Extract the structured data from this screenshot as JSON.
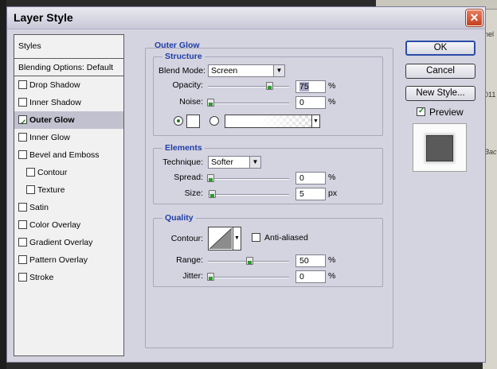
{
  "window": {
    "title": "Layer Style",
    "close_glyph": "✕"
  },
  "background_app": {
    "fragments": [
      "nel",
      "011",
      "Bac"
    ]
  },
  "styles_list": {
    "header": "Styles",
    "items": [
      {
        "label": "Blending Options: Default",
        "checkbox": false,
        "checked": false,
        "indent": 0
      },
      {
        "label": "Drop Shadow",
        "checkbox": true,
        "checked": false,
        "indent": 0
      },
      {
        "label": "Inner Shadow",
        "checkbox": true,
        "checked": false,
        "indent": 0
      },
      {
        "label": "Outer Glow",
        "checkbox": true,
        "checked": true,
        "indent": 0,
        "active": true
      },
      {
        "label": "Inner Glow",
        "checkbox": true,
        "checked": false,
        "indent": 0
      },
      {
        "label": "Bevel and Emboss",
        "checkbox": true,
        "checked": false,
        "indent": 0
      },
      {
        "label": "Contour",
        "checkbox": true,
        "checked": false,
        "indent": 1
      },
      {
        "label": "Texture",
        "checkbox": true,
        "checked": false,
        "indent": 1
      },
      {
        "label": "Satin",
        "checkbox": true,
        "checked": false,
        "indent": 0
      },
      {
        "label": "Color Overlay",
        "checkbox": true,
        "checked": false,
        "indent": 0
      },
      {
        "label": "Gradient Overlay",
        "checkbox": true,
        "checked": false,
        "indent": 0
      },
      {
        "label": "Pattern Overlay",
        "checkbox": true,
        "checked": false,
        "indent": 0
      },
      {
        "label": "Stroke",
        "checkbox": true,
        "checked": false,
        "indent": 0
      }
    ]
  },
  "outer_glow": {
    "title": "Outer Glow",
    "structure": {
      "title": "Structure",
      "blend_mode_label": "Blend Mode:",
      "blend_mode_value": "Screen",
      "opacity_label": "Opacity:",
      "opacity_value": "75",
      "opacity_level_percent": 75,
      "noise_label": "Noise:",
      "noise_value": "0",
      "noise_level_percent": 0,
      "percent_unit": "%",
      "color_radio_selected": true,
      "glow_color": "#ffffff"
    },
    "elements": {
      "title": "Elements",
      "technique_label": "Technique:",
      "technique_value": "Softer",
      "spread_label": "Spread:",
      "spread_value": "0",
      "spread_level_percent": 0,
      "spread_unit": "%",
      "size_label": "Size:",
      "size_value": "5",
      "size_level_percent": 2,
      "size_unit": "px"
    },
    "quality": {
      "title": "Quality",
      "contour_label": "Contour:",
      "anti_aliased_label": "Anti-aliased",
      "anti_aliased_checked": false,
      "range_label": "Range:",
      "range_value": "50",
      "range_level_percent": 50,
      "range_unit": "%",
      "jitter_label": "Jitter:",
      "jitter_value": "0",
      "jitter_level_percent": 0,
      "jitter_unit": "%"
    }
  },
  "buttons": {
    "ok": "OK",
    "cancel": "Cancel",
    "new_style": "New Style...",
    "preview_label": "Preview",
    "preview_checked": true
  },
  "colors": {
    "dialog_bg": "#d4d3e0",
    "group_title": "#1f3ea6",
    "active_row": "#c2c1cf",
    "check_green": "#1b7c1b",
    "preview_swatch": "#5a5a5a"
  }
}
